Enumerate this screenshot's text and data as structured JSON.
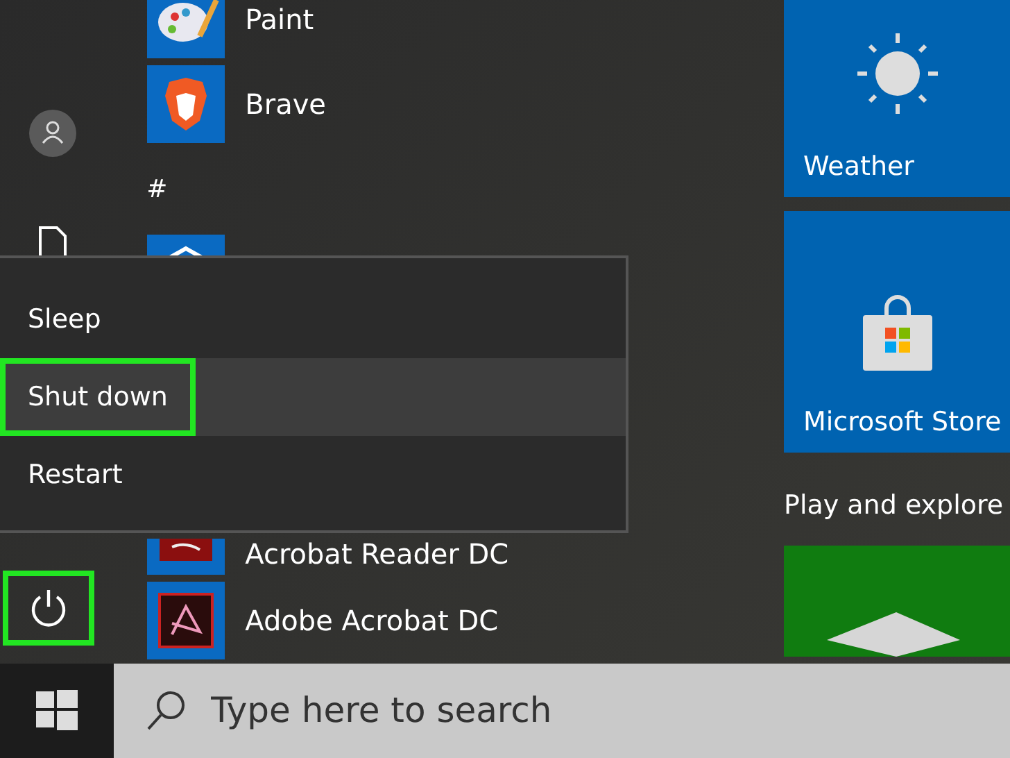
{
  "apps": [
    {
      "kind": "paint",
      "label": "Paint"
    },
    {
      "kind": "brave",
      "label": "Brave"
    },
    {
      "kind": "letter",
      "label": "#"
    },
    {
      "kind": "hexagon"
    },
    {
      "kind": "reader",
      "label": "Acrobat Reader DC"
    },
    {
      "kind": "acrobat",
      "label": "Adobe Acrobat DC"
    }
  ],
  "power_menu": {
    "items": [
      {
        "label": "Sleep",
        "selected": false,
        "annotated": false
      },
      {
        "label": "Shut down",
        "selected": true,
        "annotated": true
      },
      {
        "label": "Restart",
        "selected": false,
        "annotated": false
      }
    ]
  },
  "power_button": {
    "annotated": true
  },
  "tiles": [
    {
      "kind": "weather",
      "label": "Weather"
    },
    {
      "kind": "store",
      "label": "Microsoft Store"
    },
    {
      "kind": "heading",
      "label": "Play and explore"
    },
    {
      "kind": "game"
    }
  ],
  "taskbar": {
    "search": {
      "placeholder": "Type here to search"
    }
  }
}
